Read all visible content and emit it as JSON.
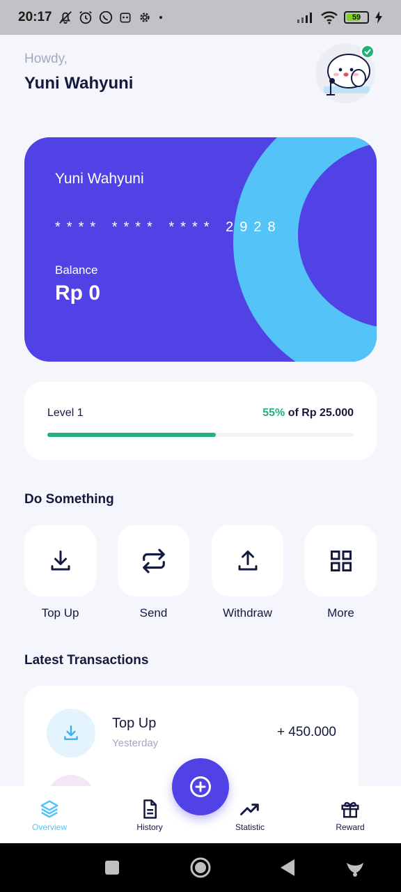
{
  "status_bar": {
    "time": "20:17",
    "battery": "59"
  },
  "header": {
    "greeting": "Howdy,",
    "name": "Yuni Wahyuni"
  },
  "card": {
    "holder": "Yuni Wahyuni",
    "number": "**** **** **** 2928",
    "balance_label": "Balance",
    "balance": "Rp 0",
    "colors": {
      "card_bg": "#5142e5",
      "ring": "#54c4f8"
    }
  },
  "level": {
    "label": "Level 1",
    "percent_text": "55%",
    "target_text": "of Rp 25.000",
    "progress": 0.55
  },
  "actions_section": {
    "title": "Do Something",
    "items": [
      {
        "label": "Top Up",
        "icon": "download-icon"
      },
      {
        "label": "Send",
        "icon": "transfer-icon"
      },
      {
        "label": "Withdraw",
        "icon": "upload-icon"
      },
      {
        "label": "More",
        "icon": "grid-icon"
      }
    ]
  },
  "transactions_section": {
    "title": "Latest Transactions",
    "items": [
      {
        "title": "Top Up",
        "time": "Yesterday",
        "amount": "+ 450.000",
        "icon": "download-icon"
      }
    ]
  },
  "bottom_nav": {
    "items": [
      {
        "label": "Overview",
        "icon": "layers-icon",
        "active": true
      },
      {
        "label": "History",
        "icon": "document-icon"
      },
      {
        "label": "Statistic",
        "icon": "trending-up-icon"
      },
      {
        "label": "Reward",
        "icon": "gift-icon"
      }
    ],
    "fab_icon": "plus-circle-icon"
  },
  "colors": {
    "primary": "#5142e5",
    "accent": "#54c4f8",
    "success": "#22b07d",
    "text": "#14193f",
    "muted": "#a4a7bd"
  }
}
